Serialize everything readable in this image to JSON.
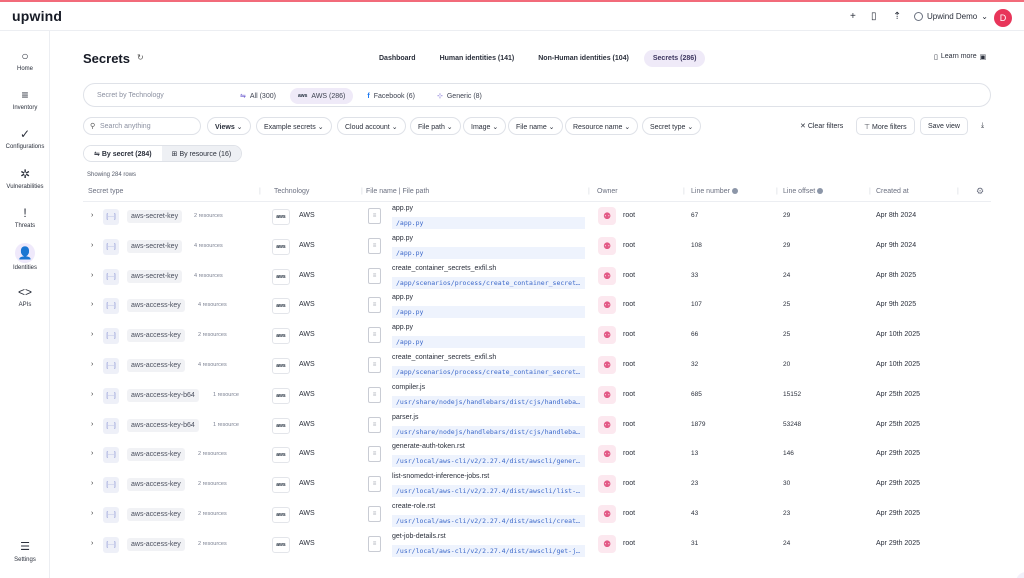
{
  "app": {
    "logo": "upwind",
    "org": "Upwind Demo",
    "user_initial": "D"
  },
  "topbar": {
    "icons": [
      "plus-icon",
      "book-icon",
      "rocket-icon"
    ]
  },
  "sidebar": {
    "items": [
      {
        "label": "Home",
        "icon": "○"
      },
      {
        "label": "Inventory",
        "icon": "≡"
      },
      {
        "label": "Configurations",
        "icon": "✓"
      },
      {
        "label": "Vulnerabilities",
        "icon": "✲"
      },
      {
        "label": "Threats",
        "icon": "!"
      },
      {
        "label": "Identities",
        "icon": "👤"
      },
      {
        "label": "APIs",
        "icon": "<>"
      }
    ],
    "settings": "Settings"
  },
  "page": {
    "title": "Secrets",
    "learn_more": "Learn more"
  },
  "tabs": [
    {
      "label": "Dashboard"
    },
    {
      "label": "Human identities (141)"
    },
    {
      "label": "Non-Human identities (104)"
    },
    {
      "label": "Secrets (286)"
    }
  ],
  "techbar": {
    "placeholder": "Secret by Technology",
    "chips": [
      {
        "label": "All (300)",
        "icon": "⇋"
      },
      {
        "label": "AWS (286)",
        "icon": "aws"
      },
      {
        "label": "Facebook (6)",
        "icon": "f"
      },
      {
        "label": "Generic (8)",
        "icon": "⊹"
      }
    ]
  },
  "filters": {
    "search_placeholder": "Search anything",
    "views": "Views",
    "items": [
      "Example secrets",
      "Cloud account",
      "File path",
      "Image",
      "File name",
      "Resource name",
      "Secret type"
    ],
    "clear": "Clear filters",
    "more": "More filters",
    "save": "Save view"
  },
  "view_toggle": {
    "by_secret": "By secret (284)",
    "by_resource": "By resource (16)"
  },
  "row_count": "Showing 284 rows",
  "columns": {
    "secret_type": "Secret type",
    "technology": "Technology",
    "file": "File name | File path",
    "owner": "Owner",
    "line_number": "Line number",
    "line_offset": "Line offset",
    "created_at": "Created at"
  },
  "rows": [
    {
      "type": "aws-secret-key",
      "resources": "2 resources",
      "tech": "AWS",
      "file": "app.py",
      "path": "/app.py",
      "owner": "root",
      "line": "67",
      "offset": "29",
      "created": "Apr 8th 2024"
    },
    {
      "type": "aws-secret-key",
      "resources": "4 resources",
      "tech": "AWS",
      "file": "app.py",
      "path": "/app.py",
      "owner": "root",
      "line": "108",
      "offset": "29",
      "created": "Apr 9th 2024"
    },
    {
      "type": "aws-secret-key",
      "resources": "4 resources",
      "tech": "AWS",
      "file": "create_container_secrets_exfil.sh",
      "path": "/app/scenarios/process/create_container_secrets_exfil.sh",
      "owner": "root",
      "line": "33",
      "offset": "24",
      "created": "Apr 8th 2025"
    },
    {
      "type": "aws-access-key",
      "resources": "4 resources",
      "tech": "AWS",
      "file": "app.py",
      "path": "/app.py",
      "owner": "root",
      "line": "107",
      "offset": "25",
      "created": "Apr 9th 2025"
    },
    {
      "type": "aws-access-key",
      "resources": "2 resources",
      "tech": "AWS",
      "file": "app.py",
      "path": "/app.py",
      "owner": "root",
      "line": "66",
      "offset": "25",
      "created": "Apr 10th 2025"
    },
    {
      "type": "aws-access-key",
      "resources": "4 resources",
      "tech": "AWS",
      "file": "create_container_secrets_exfil.sh",
      "path": "/app/scenarios/process/create_container_secrets_exfil.sh",
      "owner": "root",
      "line": "32",
      "offset": "20",
      "created": "Apr 10th 2025"
    },
    {
      "type": "aws-access-key-b64",
      "resources": "1 resource",
      "tech": "AWS",
      "file": "compiler.js",
      "path": "/usr/share/nodejs/handlebars/dist/cjs/handlebars/compiler.js",
      "owner": "root",
      "line": "685",
      "offset": "15152",
      "created": "Apr 25th 2025"
    },
    {
      "type": "aws-access-key-b64",
      "resources": "1 resource",
      "tech": "AWS",
      "file": "parser.js",
      "path": "/usr/share/nodejs/handlebars/dist/cjs/handlebars/parser.js",
      "owner": "root",
      "line": "1879",
      "offset": "53248",
      "created": "Apr 25th 2025"
    },
    {
      "type": "aws-access-key",
      "resources": "2 resources",
      "tech": "AWS",
      "file": "generate-auth-token.rst",
      "path": "/usr/local/aws-cli/v2/2.27.4/dist/awscli/generate-auth-token.rst",
      "owner": "root",
      "line": "13",
      "offset": "146",
      "created": "Apr 29th 2025"
    },
    {
      "type": "aws-access-key",
      "resources": "2 resources",
      "tech": "AWS",
      "file": "list-snomedct-inference-jobs.rst",
      "path": "/usr/local/aws-cli/v2/2.27.4/dist/awscli/list-snomedct-inference-jobs.rst",
      "owner": "root",
      "line": "23",
      "offset": "30",
      "created": "Apr 29th 2025"
    },
    {
      "type": "aws-access-key",
      "resources": "2 resources",
      "tech": "AWS",
      "file": "create-role.rst",
      "path": "/usr/local/aws-cli/v2/2.27.4/dist/awscli/create-role.rst",
      "owner": "root",
      "line": "43",
      "offset": "23",
      "created": "Apr 29th 2025"
    },
    {
      "type": "aws-access-key",
      "resources": "2 resources",
      "tech": "AWS",
      "file": "get-job-details.rst",
      "path": "/usr/local/aws-cli/v2/2.27.4/dist/awscli/get-job-details.rst",
      "owner": "root",
      "line": "31",
      "offset": "24",
      "created": "Apr 29th 2025"
    }
  ]
}
